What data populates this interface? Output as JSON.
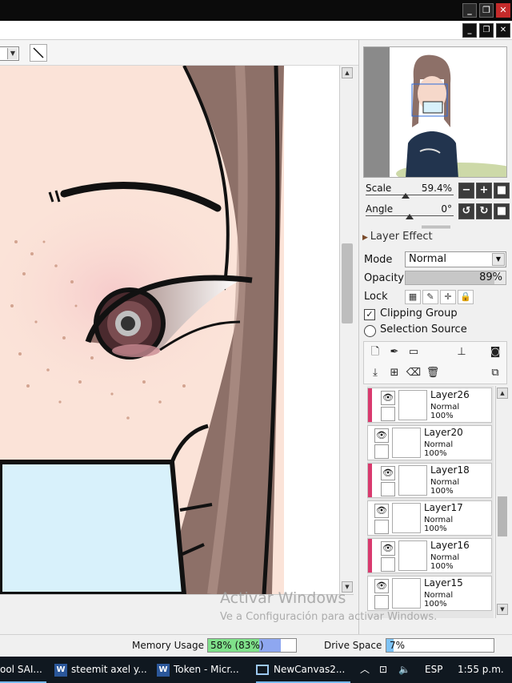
{
  "window": {
    "minimize_glyph": "_",
    "restore_glyph": "❐",
    "close_glyph": "✕"
  },
  "navigator": {
    "scale_label": "Scale",
    "scale_value": "59.4%",
    "scale_fraction": 0.45,
    "angle_label": "Angle",
    "angle_value": "0°",
    "angle_fraction": 0.5
  },
  "layer_panel": {
    "section_title": "Layer Effect",
    "mode_label": "Mode",
    "mode_value": "Normal",
    "opacity_label": "Opacity",
    "opacity_value": "89%",
    "opacity_fraction": 0.89,
    "lock_label": "Lock",
    "clipping_group_label": "Clipping Group",
    "clipping_group_checked": true,
    "selection_source_label": "Selection Source",
    "selection_source_checked": false
  },
  "layers": [
    {
      "name": "Layer26",
      "blend": "Normal",
      "opacity": "100%",
      "clipped": true
    },
    {
      "name": "Layer20",
      "blend": "Normal",
      "opacity": "100%",
      "clipped": false
    },
    {
      "name": "Layer18",
      "blend": "Normal",
      "opacity": "100%",
      "clipped": true
    },
    {
      "name": "Layer17",
      "blend": "Normal",
      "opacity": "100%",
      "clipped": false
    },
    {
      "name": "Layer16",
      "blend": "Normal",
      "opacity": "100%",
      "clipped": true
    },
    {
      "name": "Layer15",
      "blend": "Normal",
      "opacity": "100%",
      "clipped": false
    }
  ],
  "watermark": {
    "line1": "Activar Windows",
    "line2": "Ve a Configuración para activar Windows."
  },
  "statusbar": {
    "memory_label": "Memory Usage",
    "memory_value": "58% (83%)",
    "memory_fraction": 0.58,
    "memory_peak_fraction": 0.83,
    "drive_label": "Drive Space",
    "drive_value": "7%",
    "drive_fraction": 0.07
  },
  "taskbar": {
    "items": [
      {
        "label": "ool SAI...",
        "icon": "paint-tool-sai-icon"
      },
      {
        "label": "steemit axel y...",
        "icon": "word-icon"
      },
      {
        "label": "Token - Micr...",
        "icon": "word-icon"
      },
      {
        "label": "NewCanvas2...",
        "icon": "canvas-window-icon"
      }
    ],
    "language": "ESP",
    "time": "1:55 p.m."
  },
  "colors": {
    "clip_bar": "#d93a6e",
    "memory_fill": "#7fe08a",
    "memory_peak_fill": "#8ea7f0",
    "drive_fill": "#7ec3f5",
    "skin": "#fbe3d8",
    "hair": "#8d7068",
    "mask": "#d8f1fb"
  }
}
